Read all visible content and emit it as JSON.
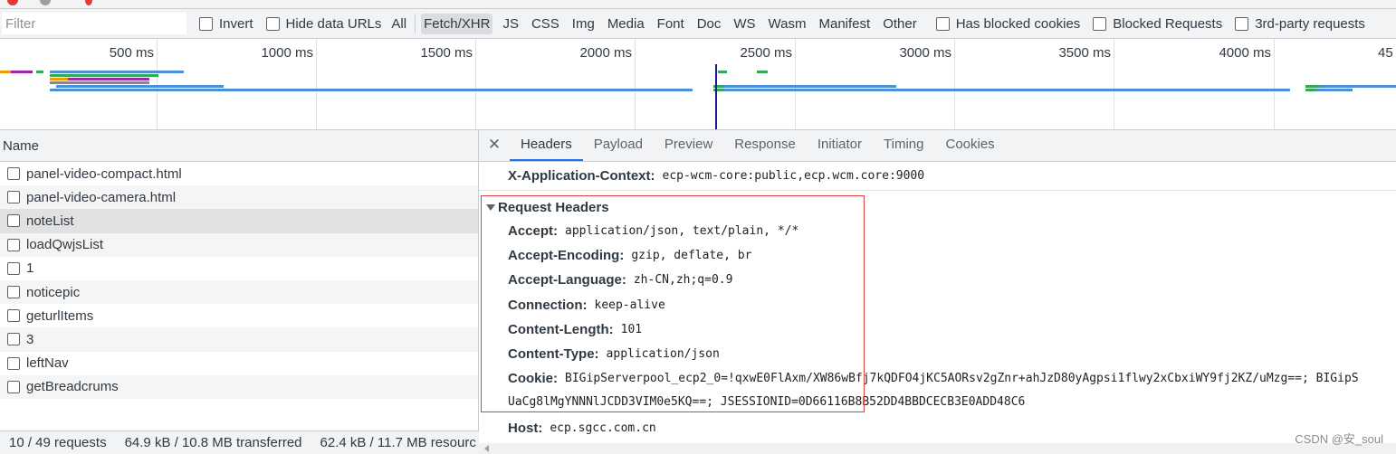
{
  "filter": {
    "placeholder": "Filter"
  },
  "filter_bar": {
    "invert_label": "Invert",
    "hide_data_urls_label": "Hide data URLs",
    "types": [
      "All",
      "Fetch/XHR",
      "JS",
      "CSS",
      "Img",
      "Media",
      "Font",
      "Doc",
      "WS",
      "Wasm",
      "Manifest",
      "Other"
    ],
    "selected_type": "Fetch/XHR",
    "has_blocked_cookies_label": "Has blocked cookies",
    "blocked_requests_label": "Blocked Requests",
    "third_party_label": "3rd-party requests"
  },
  "timeline": {
    "ticks": [
      "500 ms",
      "1000 ms",
      "1500 ms",
      "2000 ms",
      "2500 ms",
      "3000 ms",
      "3500 ms",
      "4000 ms",
      "45"
    ]
  },
  "requests": {
    "column_name": "Name",
    "items": [
      "panel-video-compact.html",
      "panel-video-camera.html",
      "noteList",
      "loadQwjsList",
      "1",
      "noticepic",
      "geturlItems",
      "3",
      "leftNav",
      "getBreadcrums"
    ],
    "selected_index": 2
  },
  "status": {
    "requests": "10 / 49 requests",
    "transferred": "64.9 kB / 10.8 MB transferred",
    "resources": "62.4 kB / 11.7 MB resourc"
  },
  "detail": {
    "close_symbol": "✕",
    "tabs": [
      "Headers",
      "Payload",
      "Preview",
      "Response",
      "Initiator",
      "Timing",
      "Cookies"
    ],
    "active_tab": "Headers",
    "context_header": {
      "name": "X-Application-Context:",
      "value": "ecp-wcm-core:public,ecp.wcm.core:9000"
    },
    "request_headers_title": "Request Headers",
    "headers": [
      {
        "name": "Accept:",
        "value": "application/json, text/plain, */*"
      },
      {
        "name": "Accept-Encoding:",
        "value": "gzip, deflate, br"
      },
      {
        "name": "Accept-Language:",
        "value": "zh-CN,zh;q=0.9"
      },
      {
        "name": "Connection:",
        "value": "keep-alive"
      },
      {
        "name": "Content-Length:",
        "value": "101"
      },
      {
        "name": "Content-Type:",
        "value": "application/json"
      },
      {
        "name": "Cookie:",
        "value": "BIGipServerpool_ecp2_0=!qxwE0FlAxm/XW86wBfj7kQDFO4jKC5AORsv2gZnr+ahJzD80yAgpsi1flwy2xCbxiWY9fj2KZ/uMzg==; BIGipS"
      },
      {
        "name": "",
        "value": "UaCg8lMgYNNNlJCDD3VIM0e5KQ==; JSESSIONID=0D66116B8B52DD4BBDCECB3E0ADD48C6"
      },
      {
        "name": "Host:",
        "value": "ecp.sgcc.com.cn"
      }
    ]
  },
  "watermark": "CSDN @安_soul",
  "colors": {
    "selected_tab_underline": "#1a73e8",
    "highlight_box": "#e04040",
    "waterfall_blue": "#4a90d9",
    "waterfall_green": "#34a853",
    "waterfall_purple": "#9c27b0",
    "waterfall_orange": "#f29900"
  }
}
